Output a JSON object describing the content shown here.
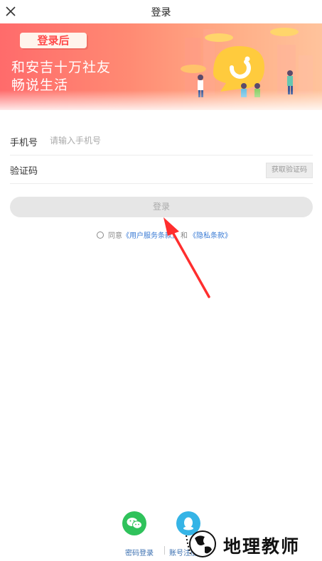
{
  "header": {
    "title": "登录",
    "close_icon": "close-icon"
  },
  "banner": {
    "badge": "登录后",
    "line1": "和安吉十万社友",
    "line2": "畅说生活",
    "colors": {
      "start": "#ff6b6b",
      "end": "#ffc39c"
    }
  },
  "form": {
    "phone_label": "手机号",
    "phone_placeholder": "请输入手机号",
    "phone_value": "",
    "code_label": "验证码",
    "code_value": "",
    "get_code_button": "获取验证码",
    "login_button": "登录"
  },
  "agreement": {
    "prefix": "同意",
    "terms_link": "《用户服务条款》",
    "conjunction": "和",
    "privacy_link": "《隐私条款》"
  },
  "social_login": {
    "wechat_icon": "wechat-icon",
    "qq_icon": "qq-icon",
    "password_login": "密码登录",
    "account_register": "账号注册"
  },
  "watermark": {
    "text": "地理教师"
  },
  "colors": {
    "accent_red": "#ff3b3b",
    "link_blue": "#3a7bd5",
    "wechat_green": "#2fc25b",
    "qq_blue": "#35b4e6"
  }
}
